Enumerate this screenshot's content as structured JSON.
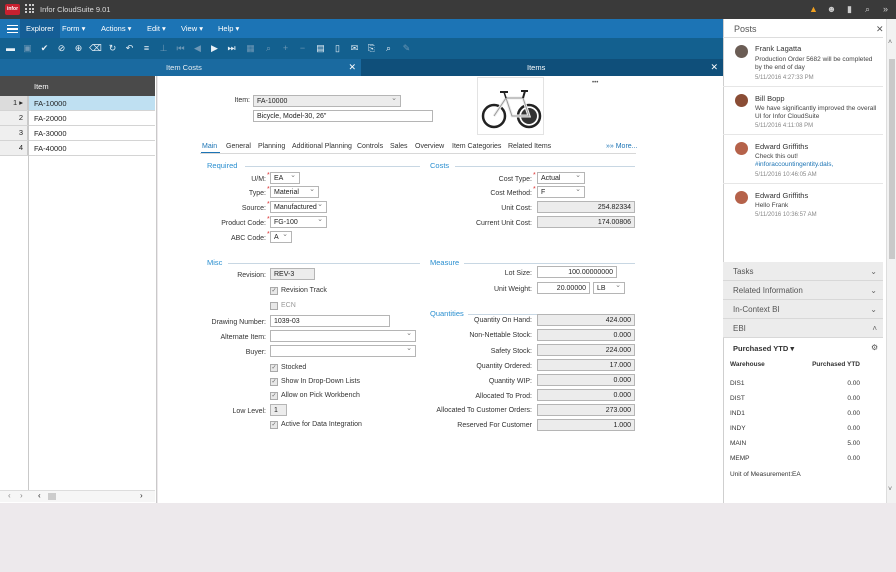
{
  "app": {
    "title": "Infor CloudSuite 9.01",
    "logo_text": "infor"
  },
  "menubar": {
    "items": [
      {
        "label": "Explorer"
      },
      {
        "label": "Form ▾"
      },
      {
        "label": "Actions ▾"
      },
      {
        "label": "Edit ▾"
      },
      {
        "label": "View ▾"
      },
      {
        "label": "Help ▾"
      }
    ]
  },
  "tabs": [
    {
      "label": "Item Costs"
    },
    {
      "label": "Items"
    }
  ],
  "grid": {
    "column_header": "Item",
    "rows": [
      {
        "num": "1",
        "value": "FA-10000"
      },
      {
        "num": "2",
        "value": "FA-20000"
      },
      {
        "num": "3",
        "value": "FA-30000"
      },
      {
        "num": "4",
        "value": "FA-40000"
      }
    ]
  },
  "form": {
    "item_label": "Item:",
    "item_value": "FA-10000",
    "description_value": "Bicycle, Model-30, 26\"",
    "more_dots": "•••",
    "tabs": [
      "Main",
      "General",
      "Planning",
      "Additional Planning",
      "Controls",
      "Sales",
      "Overview",
      "Item Categories",
      "Related Items"
    ],
    "more_tabs": "»» More...",
    "required": {
      "title": "Required",
      "um_label": "U/M:",
      "um_value": "EA",
      "type_label": "Type:",
      "type_value": "Material",
      "source_label": "Source:",
      "source_value": "Manufactured",
      "product_code_label": "Product Code:",
      "product_code_value": "FG-100",
      "abc_label": "ABC Code:",
      "abc_value": "A"
    },
    "costs": {
      "title": "Costs",
      "cost_type_label": "Cost Type:",
      "cost_type_value": "Actual",
      "cost_method_label": "Cost Method:",
      "cost_method_value": "F",
      "unit_cost_label": "Unit Cost:",
      "unit_cost_value": "254.82334",
      "current_unit_cost_label": "Current Unit Cost:",
      "current_unit_cost_value": "174.00806"
    },
    "misc": {
      "title": "Misc",
      "revision_label": "Revision:",
      "revision_value": "REV-3",
      "revision_track_label": "Revision Track",
      "ecn_label": "ECN",
      "drawing_label": "Drawing Number:",
      "drawing_value": "1039-03",
      "alternate_label": "Alternate Item:",
      "alternate_value": "",
      "buyer_label": "Buyer:",
      "buyer_value": "",
      "stocked_label": "Stocked",
      "show_dropdown_label": "Show In Drop-Down Lists",
      "allow_pick_label": "Allow on Pick Workbench",
      "low_level_label": "Low Level:",
      "low_level_value": "1",
      "active_label": "Active for Data Integration"
    },
    "measure": {
      "title": "Measure",
      "lot_size_label": "Lot Size:",
      "lot_size_value": "100.00000000",
      "unit_weight_label": "Unit Weight:",
      "unit_weight_value": "20.00000",
      "weight_unit": "LB"
    },
    "quantities": {
      "title": "Quantities",
      "rows": [
        {
          "label": "Quantity On Hand:",
          "value": "424.000"
        },
        {
          "label": "Non-Nettable Stock:",
          "value": "0.000"
        },
        {
          "label": "Safety Stock:",
          "value": "224.000"
        },
        {
          "label": "Quantity Ordered:",
          "value": "17.000"
        },
        {
          "label": "Quantity WIP:",
          "value": "0.000"
        },
        {
          "label": "Allocated To Prod:",
          "value": "0.000"
        },
        {
          "label": "Allocated To Customer Orders:",
          "value": "273.000"
        },
        {
          "label": "Reserved For Customer",
          "value": "1.000"
        }
      ]
    }
  },
  "posts": {
    "title": "Posts",
    "items": [
      {
        "name": "Frank Lagatta",
        "text": "Production Order 5682 will be completed by the end of day",
        "time": "5/11/2016 4:27:33 PM"
      },
      {
        "name": "Bill Bopp",
        "text": "We have significantly improved the overall UI for Infor CloudSuite",
        "time": "5/11/2016 4:11:08 PM"
      },
      {
        "name": "Edward Griffiths",
        "text": "Check this out!",
        "link": "#inforaccountingentity.dals,",
        "time": "5/11/2016 10:46:05 AM"
      },
      {
        "name": "Edward Griffiths",
        "text": "Hello Frank",
        "time": "5/11/2016 10:36:57 AM"
      }
    ]
  },
  "right_sections": [
    {
      "label": "Tasks"
    },
    {
      "label": "Related Information"
    },
    {
      "label": "In-Context BI"
    },
    {
      "label": "EBI"
    }
  ],
  "ebi": {
    "title": "Purchased YTD ▾",
    "col_warehouse": "Warehouse",
    "col_value": "Purchased YTD",
    "rows": [
      {
        "warehouse": "DIS1",
        "value": "0.00"
      },
      {
        "warehouse": "DIST",
        "value": "0.00"
      },
      {
        "warehouse": "IND1",
        "value": "0.00"
      },
      {
        "warehouse": "INDY",
        "value": "0.00"
      },
      {
        "warehouse": "MAIN",
        "value": "5.00"
      },
      {
        "warehouse": "MEMP",
        "value": "0.00"
      }
    ],
    "uom_label": "Unit of Measurement:",
    "uom_value": "EA"
  }
}
